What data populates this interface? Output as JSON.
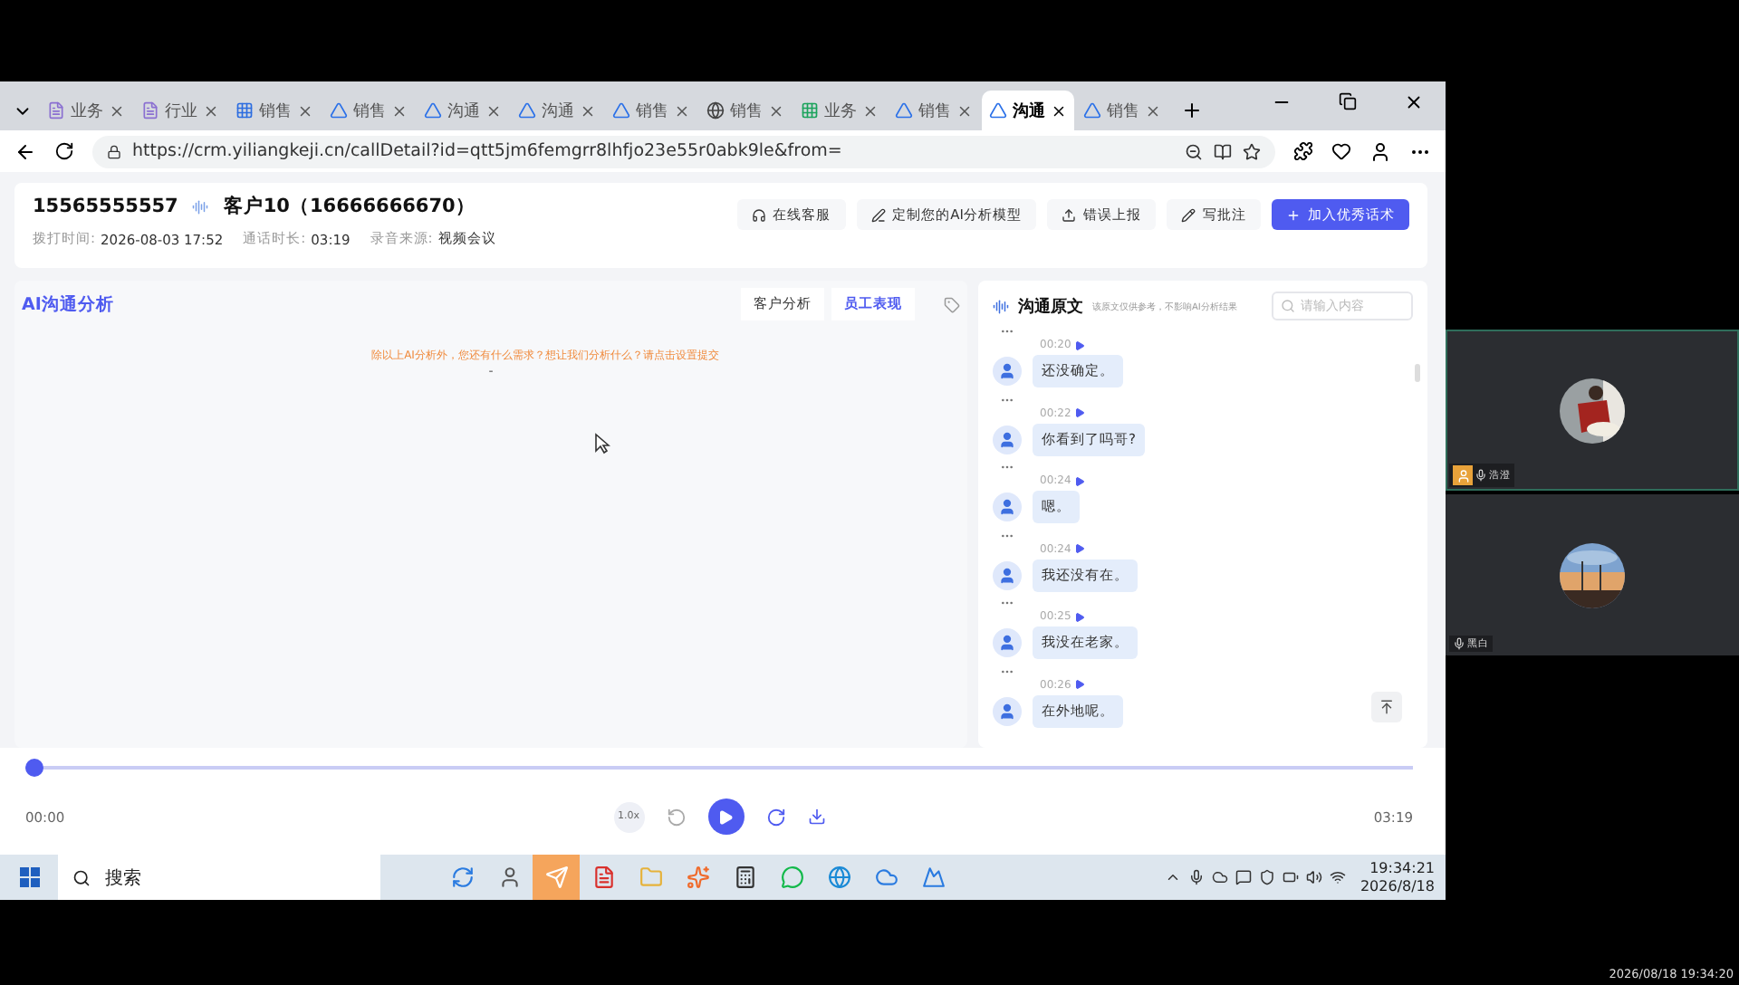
{
  "browser": {
    "tabs": [
      {
        "label": "业务",
        "selected": false
      },
      {
        "label": "行业",
        "selected": false
      },
      {
        "label": "销售",
        "selected": false
      },
      {
        "label": "销售",
        "selected": false
      },
      {
        "label": "沟通",
        "selected": false
      },
      {
        "label": "沟通",
        "selected": false
      },
      {
        "label": "销售",
        "selected": false
      },
      {
        "label": "销售",
        "selected": false
      },
      {
        "label": "业务",
        "selected": false
      },
      {
        "label": "销售",
        "selected": false
      },
      {
        "label": "沟通",
        "selected": true
      },
      {
        "label": "销售",
        "selected": false
      }
    ],
    "url": "https://crm.yiliangkeji.cn/callDetail?id=qtt5jm6femgrr8lhfjo23e55r0abk9le&from="
  },
  "header": {
    "phone": "15565555557",
    "customer": "客户10（16666666670）",
    "meta": [
      {
        "label": "拨打时间:",
        "value": "2026-08-03 17:52"
      },
      {
        "label": "通话时长:",
        "value": "03:19"
      },
      {
        "label": "录音来源:",
        "value": "视频会议"
      }
    ],
    "actions": [
      {
        "label": "在线客服",
        "kind": "service"
      },
      {
        "label": "定制您的AI分析模型",
        "kind": "custom"
      },
      {
        "label": "错误上报",
        "kind": "report"
      },
      {
        "label": "写批注",
        "kind": "note"
      },
      {
        "label": "加入优秀话术",
        "kind": "primary"
      }
    ]
  },
  "analysis": {
    "title": "AI沟通分析",
    "tabs": [
      {
        "label": "客户分析",
        "selected": false
      },
      {
        "label": "员工表现",
        "selected": true
      }
    ],
    "notice": "除以上AI分析外，您还有什么需求？想让我们分析什么？请点击设置提交",
    "dash": "-"
  },
  "transcript": {
    "title": "沟通原文",
    "note": "该原文仅供参考，不影响AI分析结果",
    "search_placeholder": "请输入内容",
    "messages": [
      {
        "time": "00:20",
        "text": "还没确定。"
      },
      {
        "time": "00:22",
        "text": "你看到了吗哥?"
      },
      {
        "time": "00:24",
        "text": "嗯。"
      },
      {
        "time": "00:24",
        "text": "我还没有在。"
      },
      {
        "time": "00:25",
        "text": "我没在老家。"
      },
      {
        "time": "00:26",
        "text": "在外地呢。"
      }
    ]
  },
  "player": {
    "level": 0,
    "speed": "1.0x",
    "current": "00:00",
    "total": "03:19"
  },
  "taskbar": {
    "search": "搜索",
    "time": "19:34:21",
    "date": "2026/8/18"
  },
  "participants": [
    {
      "name": "浩澄",
      "host": true
    },
    {
      "name": "黑白",
      "host": false
    }
  ],
  "timestamp": "2026/08/18 19:34:20"
}
